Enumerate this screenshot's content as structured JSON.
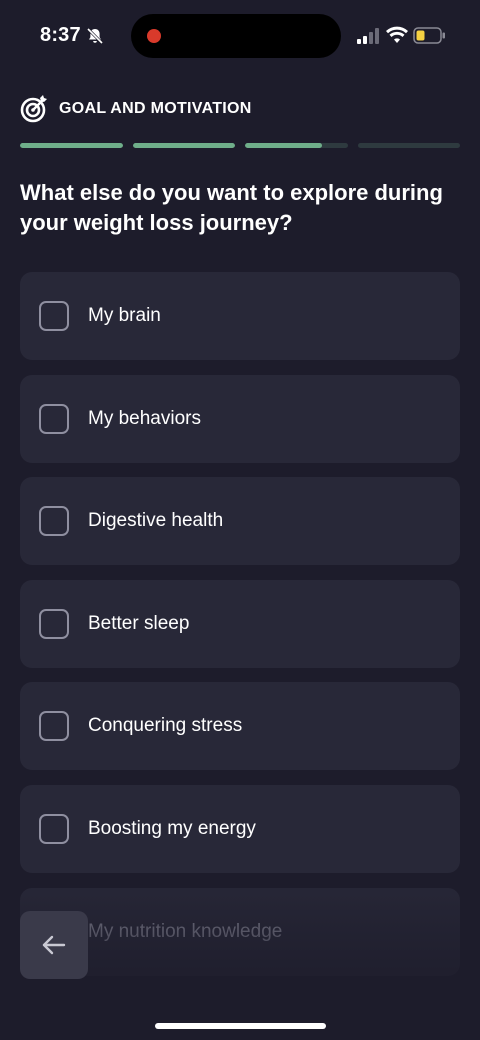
{
  "status_bar": {
    "time": "8:37",
    "icons": [
      "bell-slash-icon",
      "signal-icon",
      "wifi-icon",
      "battery-low-icon"
    ],
    "recording_color": "#d93a2b",
    "battery_color": "#f5d142"
  },
  "header": {
    "icon": "target-icon",
    "title": "GOAL AND MOTIVATION",
    "progress_segments": [
      1.0,
      1.0,
      0.75,
      0.0
    ],
    "accent_color": "#6fae8a"
  },
  "question": "What else do you want to explore during your weight loss journey?",
  "options": [
    {
      "label": "My brain",
      "checked": false
    },
    {
      "label": "My behaviors",
      "checked": false
    },
    {
      "label": "Digestive health",
      "checked": false
    },
    {
      "label": "Better sleep",
      "checked": false
    },
    {
      "label": "Conquering stress",
      "checked": false
    },
    {
      "label": "Boosting my energy",
      "checked": false
    },
    {
      "label": "My nutrition knowledge",
      "checked": false
    }
  ],
  "navigation": {
    "back_icon": "arrow-left-icon"
  }
}
